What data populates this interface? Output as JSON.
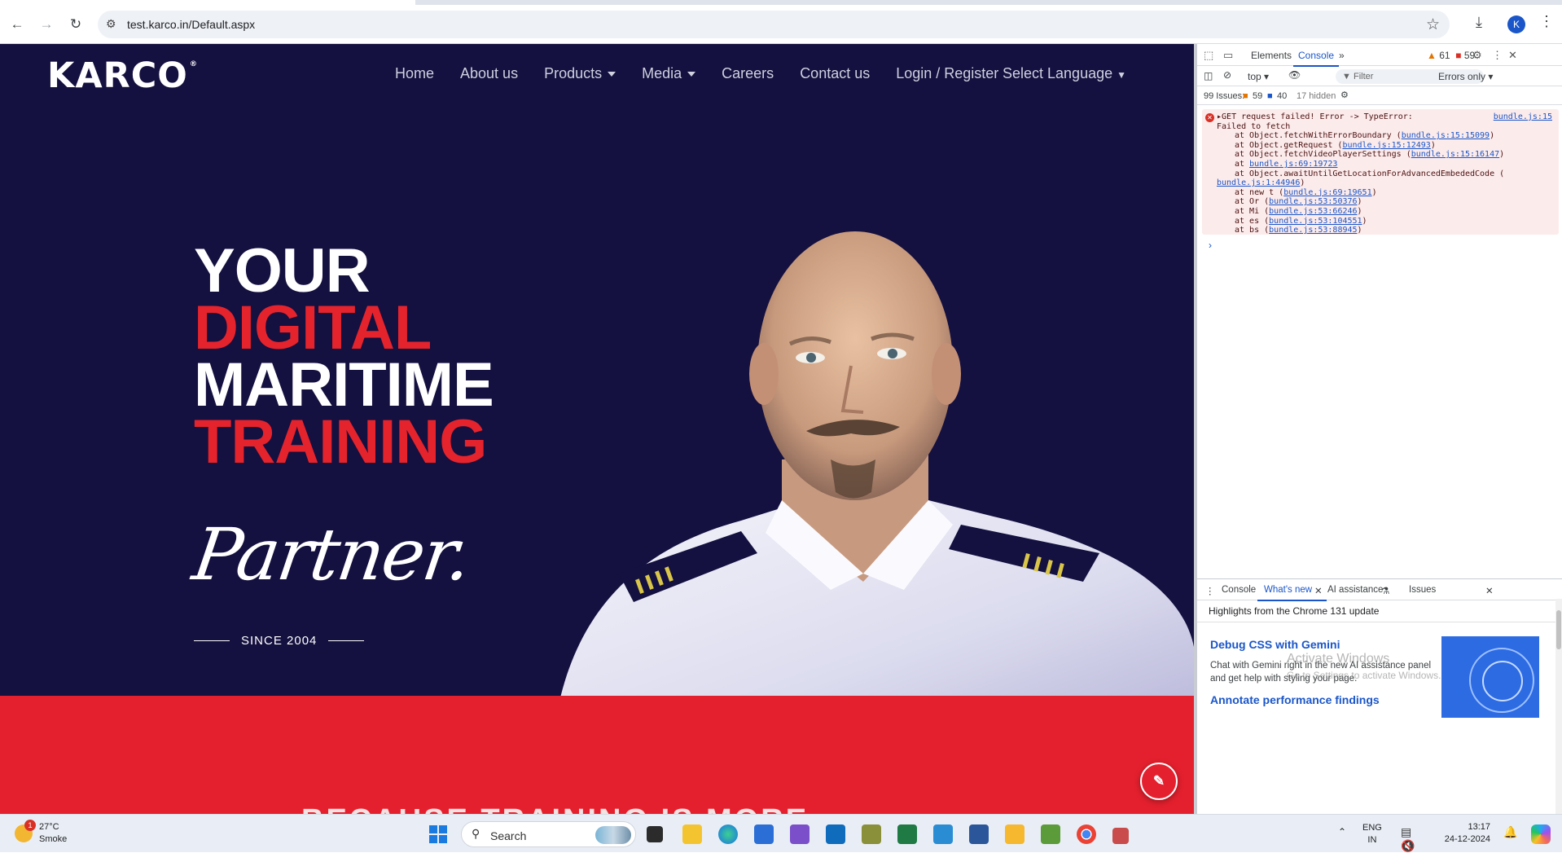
{
  "browser": {
    "url": "test.karco.in/Default.aspx",
    "profile_initial": "K"
  },
  "site": {
    "logo": "KARCO",
    "logo_mark": "®",
    "nav": [
      {
        "label": "Home",
        "dropdown": false
      },
      {
        "label": "About us",
        "dropdown": false
      },
      {
        "label": "Products",
        "dropdown": true
      },
      {
        "label": "Media",
        "dropdown": true
      },
      {
        "label": "Careers",
        "dropdown": false
      },
      {
        "label": "Contact us",
        "dropdown": false
      },
      {
        "label": "Login / Register",
        "dropdown": false
      }
    ],
    "language": "Select Language",
    "hero": {
      "line1": "YOUR",
      "line2": "DIGITAL",
      "line3": "MARITIME",
      "line4": "TRAINING",
      "script": "Partner.",
      "since": "SINCE 2004"
    },
    "banner_text": "BECAUSE TRAINING IS MORE",
    "colors": {
      "navy": "#14103f",
      "red": "#e5202e"
    }
  },
  "devtools": {
    "tabs": [
      "Elements",
      "Console"
    ],
    "active_tab": "Console",
    "warnings": "61",
    "errors": "59",
    "context": "top",
    "filter_placeholder": "Filter",
    "level": "Errors only",
    "issues_label": "99 Issues:",
    "issues_err": "59",
    "issues_info": "40",
    "hidden": "17 hidden",
    "error": {
      "message_a": "GET request failed! Error ->  TypeError:",
      "message_b": "Failed to fetch",
      "source": "bundle.js:15",
      "stack": [
        {
          "text": "at Object.fetchWithErrorBoundary (",
          "link": "bundle.js:15:15099",
          "tail": ")"
        },
        {
          "text": "at Object.getRequest (",
          "link": "bundle.js:15:12493",
          "tail": ")"
        },
        {
          "text": "at Object.fetchVideoPlayerSettings (",
          "link": "bundle.js:15:16147",
          "tail": ")"
        },
        {
          "text": "at ",
          "link": "bundle.js:69:19723",
          "tail": ""
        },
        {
          "text": "at Object.awaitUntilGetLocationForAdvancedEmbededCode (",
          "link": "",
          "tail": ""
        },
        {
          "text": "",
          "link": "bundle.js:1:44946",
          "tail": ")",
          "wrap": true
        },
        {
          "text": "at new t (",
          "link": "bundle.js:69:19651",
          "tail": ")"
        },
        {
          "text": "at Or (",
          "link": "bundle.js:53:50376",
          "tail": ")"
        },
        {
          "text": "at Mi (",
          "link": "bundle.js:53:66246",
          "tail": ")"
        },
        {
          "text": "at es (",
          "link": "bundle.js:53:104551",
          "tail": ")"
        },
        {
          "text": "at bs (",
          "link": "bundle.js:53:88945",
          "tail": ")"
        }
      ]
    },
    "drawer": {
      "tabs": [
        "Console",
        "What's new",
        "AI assistance",
        "Issues"
      ],
      "active": "What's new",
      "title": "Highlights from the Chrome 131 update",
      "h1": "Debug CSS with Gemini",
      "p": "Chat with Gemini right in the new AI assistance panel and get help with styling your page.",
      "h2": "Annotate performance findings"
    },
    "watermark_1": "Activate Windows",
    "watermark_2": "Go to Settings to activate Windows."
  },
  "taskbar": {
    "weather_temp": "27°C",
    "weather_desc": "Smoke",
    "weather_badge": "1",
    "search": "Search",
    "lang": "ENG",
    "region": "IN",
    "time": "13:17",
    "date": "24-12-2024"
  }
}
